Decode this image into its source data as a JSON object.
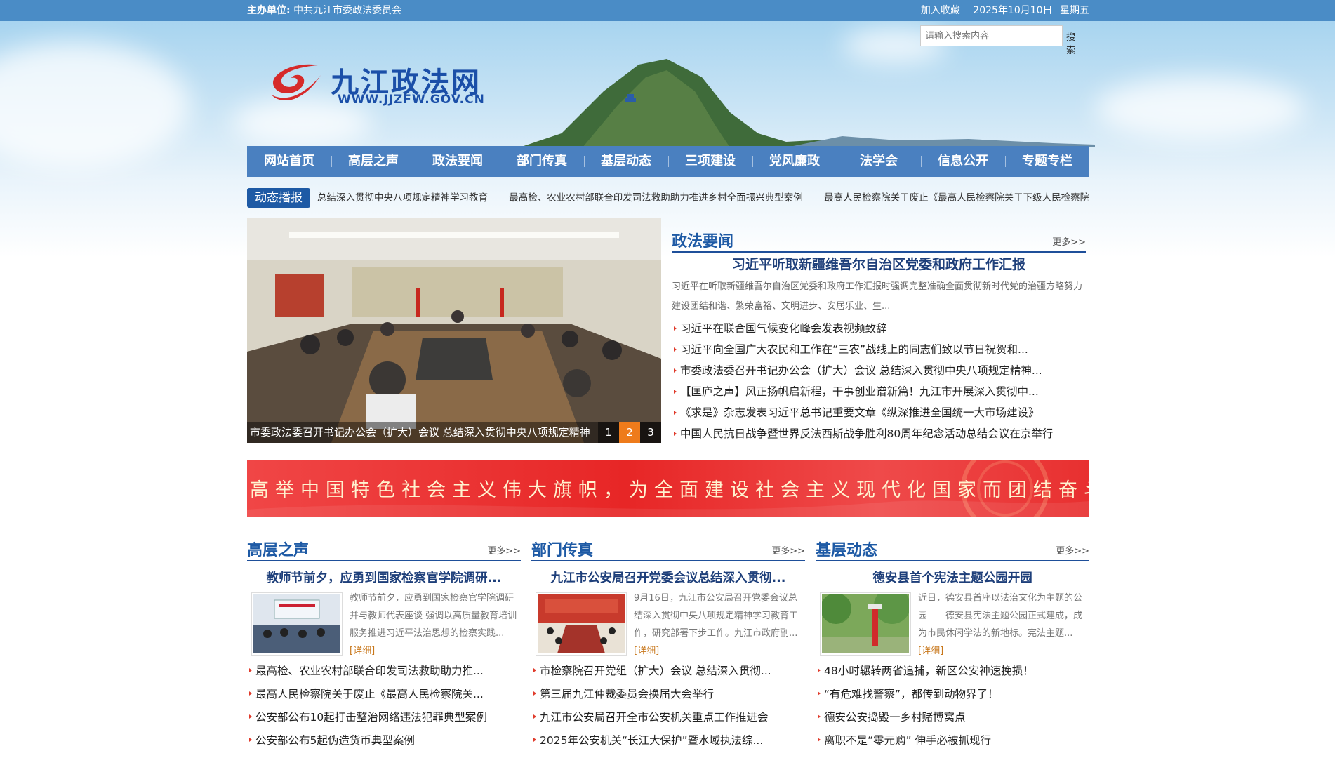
{
  "topbar": {
    "host_label": "主办单位:",
    "host_value": "中共九江市委政法委员会",
    "bookmark": "加入收藏",
    "date": "2025年10月10日",
    "weekday": "星期五"
  },
  "search": {
    "placeholder": "请输入搜索内容",
    "button": "搜索"
  },
  "logo": {
    "name": "九江政法网",
    "url": "WWW.JJZFW.GOV.CN"
  },
  "nav": [
    "网站首页",
    "高层之声",
    "政法要闻",
    "部门传真",
    "基层动态",
    "三项建设",
    "党风廉政",
    "法学会",
    "信息公开",
    "专题专栏"
  ],
  "ticker": {
    "label": "动态播报",
    "items": [
      "总结深入贯彻中央八项规定精神学习教育",
      "最高检、农业农村部联合印发司法救助助力推进乡村全面振兴典型案例",
      "最高人民检察院关于废止《最高人民检察院关于下级人民检察院"
    ]
  },
  "slideshow": {
    "caption": "市委政法委召开书记办公会（扩大）会议 总结深入贯彻中央八项规定精神",
    "pages": [
      "1",
      "2",
      "3"
    ],
    "active_page": 2
  },
  "news": {
    "title": "政法要闻",
    "more": "更多>>",
    "headline": "习近平听取新疆维吾尔自治区党委和政府工作汇报",
    "summary": "习近平在听取新疆维吾尔自治区党委和政府工作汇报时强调完整准确全面贯彻新时代党的治疆方略努力建设团结和谐、繁荣富裕、文明进步、安居乐业、生...",
    "items": [
      "习近平在联合国气候变化峰会发表视频致辞",
      "习近平向全国广大农民和工作在“三农”战线上的同志们致以节日祝贺和...",
      "市委政法委召开书记办公会（扩大）会议 总结深入贯彻中央八项规定精神...",
      "【匡庐之声】风正扬帆启新程，干事创业谱新篇！九江市开展深入贯彻中...",
      "《求是》杂志发表习近平总书记重要文章《纵深推进全国统一大市场建设》",
      "中国人民抗日战争暨世界反法西斯战争胜利80周年纪念活动总结会议在京举行"
    ]
  },
  "banner": {
    "text": "高举中国特色社会主义伟大旗帜，为全面建设社会主义现代化国家而团结奋斗！"
  },
  "columns": [
    {
      "title": "高层之声",
      "more": "更多>>",
      "lead": "教师节前夕，应勇到国家检察官学院调研...",
      "abstract": "教师节前夕，应勇到国家检察官学院调研并与教师代表座谈 强调以高质量教育培训服务推进习近平法治思想的检察实践...",
      "detail": "[详细]",
      "items": [
        "最高检、农业农村部联合印发司法救助助力推...",
        "最高人民检察院关于废止《最高人民检察院关...",
        "公安部公布10起打击整治网络违法犯罪典型案例",
        "公安部公布5起伪造货币典型案例"
      ]
    },
    {
      "title": "部门传真",
      "more": "更多>>",
      "lead": "九江市公安局召开党委会议总结深入贯彻...",
      "abstract": "9月16日，九江市公安局召开党委会议总结深入贯彻中央八项规定精神学习教育工作，研究部署下步工作。九江市政府副...",
      "detail": "[详细]",
      "items": [
        "市检察院召开党组（扩大）会议 总结深入贯彻...",
        "第三届九江仲裁委员会换届大会举行",
        "九江市公安局召开全市公安机关重点工作推进会",
        "2025年公安机关“长江大保护”暨水域执法综..."
      ]
    },
    {
      "title": "基层动态",
      "more": "更多>>",
      "lead": "德安县首个宪法主题公园开园",
      "abstract": "近日，德安县首座以法治文化为主题的公园——德安县宪法主题公园正式建成，成为市民休闲学法的新地标。宪法主题...",
      "detail": "[详细]",
      "items": [
        "48小时辗转两省追捕，新区公安神速挽损！",
        "“有危难找警察”，都传到动物界了！",
        "德安公安捣毁一乡村赌博窝点",
        "离职不是“零元购” 伸手必被抓现行"
      ]
    }
  ],
  "colors": {
    "nav": "#4a80c0",
    "topbar": "#4a8cc6",
    "heading": "#1e5aa5",
    "banner": "#e72626",
    "pager_active": "#ee7b1b"
  }
}
